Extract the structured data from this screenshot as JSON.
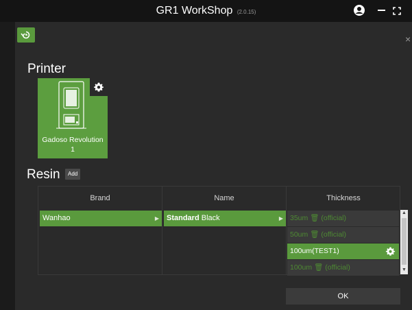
{
  "window": {
    "title": "GR1 WorkShop",
    "version": "(2.0.15)"
  },
  "printer": {
    "section_title": "Printer",
    "name": "Gadoso Revolution 1"
  },
  "resin": {
    "section_title": "Resin",
    "add_label": "Add",
    "columns": {
      "brand": "Brand",
      "name": "Name",
      "thickness": "Thickness"
    },
    "selected_brand": "Wanhao",
    "selected_name_bold": "Standard",
    "selected_name_rest": " Black",
    "thickness_items": [
      {
        "label": "35um 🗑 (official)",
        "state": "dim"
      },
      {
        "label": "50um 🗑 (official)",
        "state": "dim"
      },
      {
        "label": "100um(TEST1)",
        "state": "selected"
      },
      {
        "label": "100um 🗑 (official)",
        "state": "dim"
      }
    ]
  },
  "footer": {
    "ok_label": "OK"
  },
  "colors": {
    "accent": "#5a9a3d",
    "panel": "#2a2a2a",
    "background": "#1e1e1e"
  }
}
